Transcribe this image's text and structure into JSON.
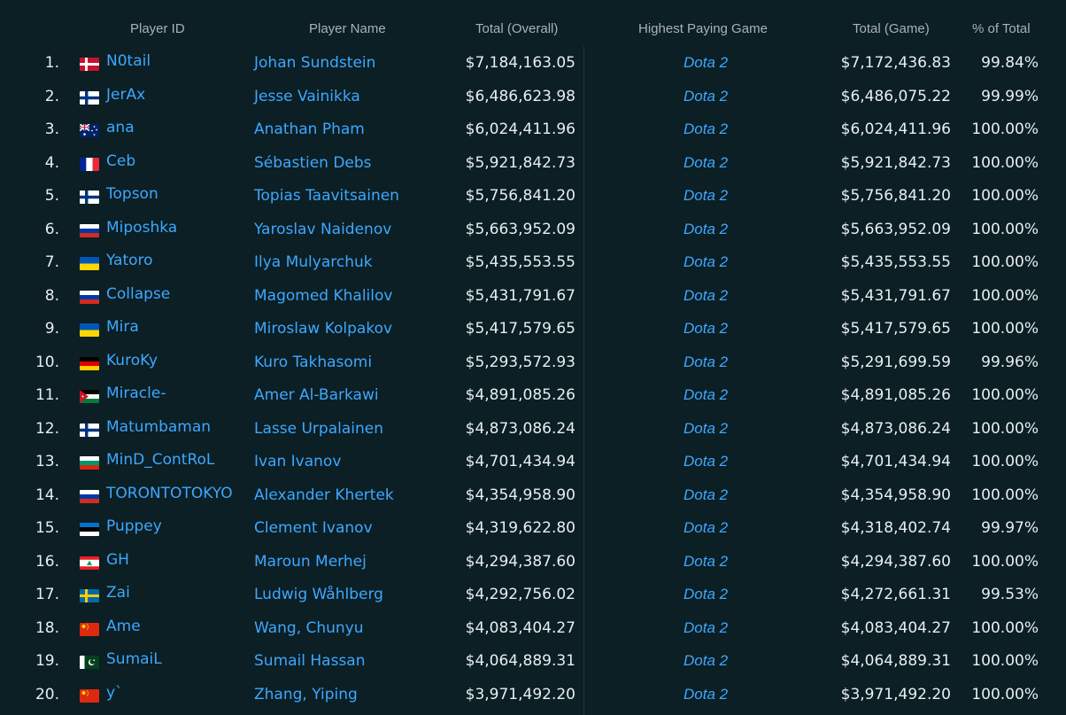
{
  "header": {
    "player_id": "Player ID",
    "player_name": "Player Name",
    "total_overall": "Total (Overall)",
    "highest_game": "Highest Paying Game",
    "total_game": "Total (Game)",
    "pct_total": "% of Total"
  },
  "colors": {
    "background": "#0b1f24",
    "link": "#3fa7ff",
    "text": "#e9eef0",
    "header_text": "#a8b2b6"
  },
  "rows": [
    {
      "rank": "1.",
      "flag": "denmark",
      "id": "N0tail",
      "name": "Johan Sundstein",
      "overall": "$7,184,163.05",
      "game": "Dota 2",
      "game_total": "$7,172,436.83",
      "pct": "99.84%"
    },
    {
      "rank": "2.",
      "flag": "finland",
      "id": "JerAx",
      "name": "Jesse Vainikka",
      "overall": "$6,486,623.98",
      "game": "Dota 2",
      "game_total": "$6,486,075.22",
      "pct": "99.99%"
    },
    {
      "rank": "3.",
      "flag": "australia",
      "id": "ana",
      "name": "Anathan Pham",
      "overall": "$6,024,411.96",
      "game": "Dota 2",
      "game_total": "$6,024,411.96",
      "pct": "100.00%"
    },
    {
      "rank": "4.",
      "flag": "france",
      "id": "Ceb",
      "name": "Sébastien Debs",
      "overall": "$5,921,842.73",
      "game": "Dota 2",
      "game_total": "$5,921,842.73",
      "pct": "100.00%"
    },
    {
      "rank": "5.",
      "flag": "finland",
      "id": "Topson",
      "name": "Topias Taavitsainen",
      "overall": "$5,756,841.20",
      "game": "Dota 2",
      "game_total": "$5,756,841.20",
      "pct": "100.00%"
    },
    {
      "rank": "6.",
      "flag": "russia",
      "id": "Miposhka",
      "name": "Yaroslav Naidenov",
      "overall": "$5,663,952.09",
      "game": "Dota 2",
      "game_total": "$5,663,952.09",
      "pct": "100.00%"
    },
    {
      "rank": "7.",
      "flag": "ukraine",
      "id": "Yatoro",
      "name": "Ilya Mulyarchuk",
      "overall": "$5,435,553.55",
      "game": "Dota 2",
      "game_total": "$5,435,553.55",
      "pct": "100.00%"
    },
    {
      "rank": "8.",
      "flag": "russia",
      "id": "Collapse",
      "name": "Magomed Khalilov",
      "overall": "$5,431,791.67",
      "game": "Dota 2",
      "game_total": "$5,431,791.67",
      "pct": "100.00%"
    },
    {
      "rank": "9.",
      "flag": "ukraine",
      "id": "Mira",
      "name": "Miroslaw Kolpakov",
      "overall": "$5,417,579.65",
      "game": "Dota 2",
      "game_total": "$5,417,579.65",
      "pct": "100.00%"
    },
    {
      "rank": "10.",
      "flag": "germany",
      "id": "KuroKy",
      "name": "Kuro Takhasomi",
      "overall": "$5,293,572.93",
      "game": "Dota 2",
      "game_total": "$5,291,699.59",
      "pct": "99.96%"
    },
    {
      "rank": "11.",
      "flag": "jordan",
      "id": "Miracle-",
      "name": "Amer Al-Barkawi",
      "overall": "$4,891,085.26",
      "game": "Dota 2",
      "game_total": "$4,891,085.26",
      "pct": "100.00%"
    },
    {
      "rank": "12.",
      "flag": "finland",
      "id": "Matumbaman",
      "name": "Lasse Urpalainen",
      "overall": "$4,873,086.24",
      "game": "Dota 2",
      "game_total": "$4,873,086.24",
      "pct": "100.00%"
    },
    {
      "rank": "13.",
      "flag": "bulgaria",
      "id": "MinD_ContRoL",
      "name": "Ivan Ivanov",
      "overall": "$4,701,434.94",
      "game": "Dota 2",
      "game_total": "$4,701,434.94",
      "pct": "100.00%"
    },
    {
      "rank": "14.",
      "flag": "russia",
      "id": "TORONTOTOKYO",
      "name": "Alexander Khertek",
      "overall": "$4,354,958.90",
      "game": "Dota 2",
      "game_total": "$4,354,958.90",
      "pct": "100.00%"
    },
    {
      "rank": "15.",
      "flag": "estonia",
      "id": "Puppey",
      "name": "Clement Ivanov",
      "overall": "$4,319,622.80",
      "game": "Dota 2",
      "game_total": "$4,318,402.74",
      "pct": "99.97%"
    },
    {
      "rank": "16.",
      "flag": "lebanon",
      "id": "GH",
      "name": "Maroun Merhej",
      "overall": "$4,294,387.60",
      "game": "Dota 2",
      "game_total": "$4,294,387.60",
      "pct": "100.00%"
    },
    {
      "rank": "17.",
      "flag": "sweden",
      "id": "Zai",
      "name": "Ludwig Wåhlberg",
      "overall": "$4,292,756.02",
      "game": "Dota 2",
      "game_total": "$4,272,661.31",
      "pct": "99.53%"
    },
    {
      "rank": "18.",
      "flag": "china",
      "id": "Ame",
      "name": "Wang, Chunyu",
      "overall": "$4,083,404.27",
      "game": "Dota 2",
      "game_total": "$4,083,404.27",
      "pct": "100.00%"
    },
    {
      "rank": "19.",
      "flag": "pakistan",
      "id": "SumaiL",
      "name": "Sumail Hassan",
      "overall": "$4,064,889.31",
      "game": "Dota 2",
      "game_total": "$4,064,889.31",
      "pct": "100.00%"
    },
    {
      "rank": "20.",
      "flag": "china",
      "id": "y`",
      "name": "Zhang, Yiping",
      "overall": "$3,971,492.20",
      "game": "Dota 2",
      "game_total": "$3,971,492.20",
      "pct": "100.00%"
    }
  ]
}
